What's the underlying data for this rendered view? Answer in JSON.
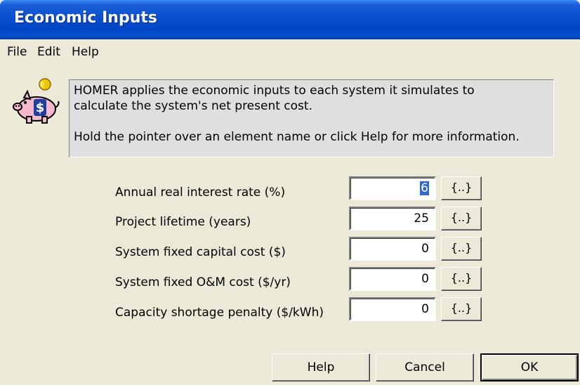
{
  "window": {
    "title": "Economic Inputs"
  },
  "menu": {
    "items": [
      "File",
      "Edit",
      "Help"
    ]
  },
  "info": {
    "icon": "piggy-bank-dollar-icon",
    "line1": "HOMER applies the economic inputs to each system it simulates to",
    "line2": "calculate the system's net present cost.",
    "line3": "Hold the pointer over an element name or click Help for more information."
  },
  "inputs": [
    {
      "label": "Annual real interest rate (%)",
      "value": "6",
      "sens": "{..}"
    },
    {
      "label": "Project lifetime (years)",
      "value": "25",
      "sens": "{..}"
    },
    {
      "label": "System fixed capital cost ($)",
      "value": "0",
      "sens": "{..}"
    },
    {
      "label": "System fixed O&M cost ($/yr)",
      "value": "0",
      "sens": "{..}"
    },
    {
      "label": "Capacity shortage penalty ($/kWh)",
      "value": "0",
      "sens": "{..}"
    }
  ],
  "buttons": {
    "help": "Help",
    "cancel": "Cancel",
    "ok": "OK"
  },
  "colors": {
    "titlebar": "#0a4fd0",
    "face": "#ece9d8",
    "infobox": "#dfdfdf",
    "selection": "#316ac5"
  }
}
